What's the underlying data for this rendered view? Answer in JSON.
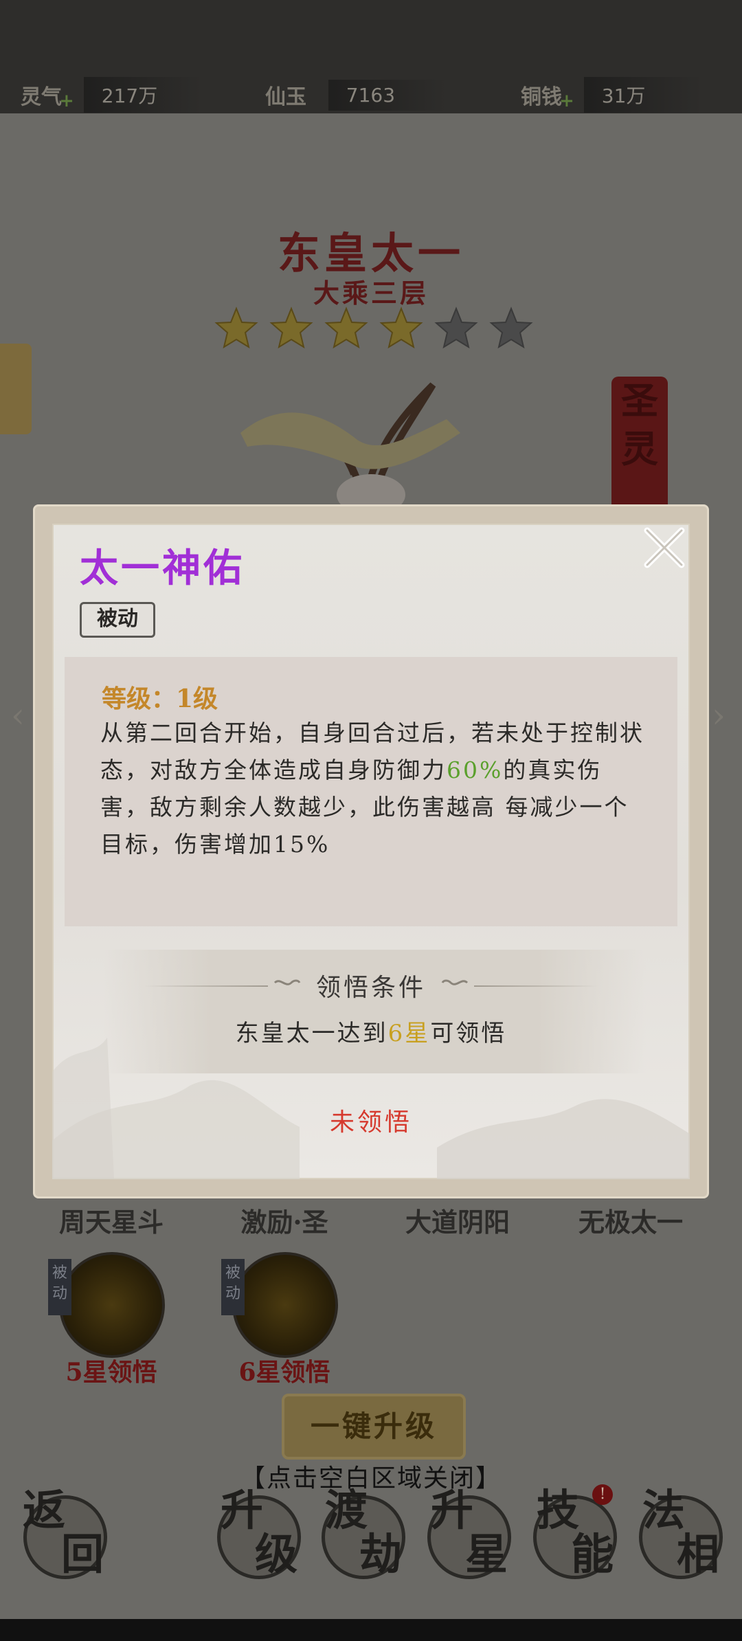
{
  "resources": [
    {
      "name": "灵气",
      "value": "217万"
    },
    {
      "name": "仙玉",
      "value": "7163"
    },
    {
      "name": "铜钱",
      "value": "31万"
    }
  ],
  "hero": {
    "name": "东皇太一",
    "realm": "大乘三层",
    "stars_filled": 4,
    "stars_total": 6,
    "banner_text": "圣灵"
  },
  "skills_bg": {
    "names": [
      "周天星斗",
      "激励·圣",
      "大道阴阳",
      "无极太一"
    ],
    "icons": [
      {
        "tag": "被动",
        "star_req": "5星领悟"
      },
      {
        "tag": "被动",
        "star_req": "6星领悟"
      }
    ],
    "upgrade_all": "一键升级",
    "close_hint": "【点击空白区域关闭】"
  },
  "nav": {
    "back": [
      "返",
      "回"
    ],
    "levelup": [
      "升",
      "级"
    ],
    "tribulation": [
      "渡",
      "劫"
    ],
    "starup": [
      "升",
      "星"
    ],
    "skill": [
      "技",
      "能"
    ],
    "form": [
      "法",
      "相"
    ],
    "badge": "!"
  },
  "dialog": {
    "title": "太一神佑",
    "type": "被动",
    "level": "等级：1级",
    "desc_1": "从第二回合开始，自身回合过后，若未处于控制状态，对敌方全体造成自身防御力",
    "desc_pct": "60%",
    "desc_2": "的真实伤害，敌方剩余人数越少，此伤害越高 每减少一个目标，伤害增加15%",
    "cond_title": "领悟条件",
    "cond_pre": "东皇太一达到",
    "cond_hl": "6星",
    "cond_post": "可领悟",
    "status": "未领悟"
  },
  "colors": {
    "title_purple": "#a12fd6",
    "level_gold": "#c4872a",
    "highlight_green": "#5aa02c",
    "highlight_gold": "#c8a020",
    "status_red": "#d63a2e"
  }
}
